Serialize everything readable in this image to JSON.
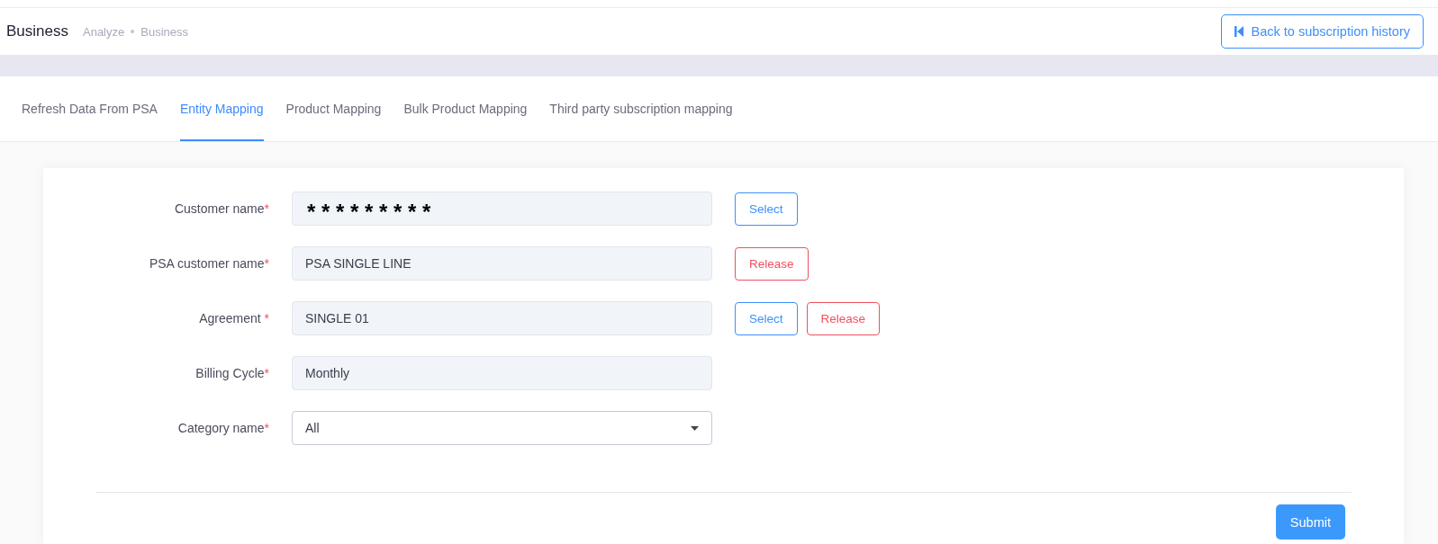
{
  "header": {
    "title": "Business",
    "breadcrumb": [
      "Analyze",
      "Business"
    ],
    "back_button": {
      "label": "Back to subscription history"
    }
  },
  "tabs": [
    {
      "label": "Refresh Data From PSA",
      "selected": false
    },
    {
      "label": "Entity Mapping",
      "selected": true
    },
    {
      "label": "Product Mapping",
      "selected": false
    },
    {
      "label": "Bulk Product Mapping",
      "selected": false
    },
    {
      "label": "Third party subscription mapping",
      "selected": false
    }
  ],
  "form": {
    "fields": [
      {
        "label": "Customer name",
        "required_mark": "*",
        "kind": "masked",
        "value": "* * * * * * * * *",
        "disabled": true,
        "actions": [
          {
            "label": "Select",
            "kind": "select"
          }
        ]
      },
      {
        "label": "PSA customer name",
        "required_mark": "*",
        "kind": "text",
        "value": "PSA SINGLE LINE",
        "disabled": true,
        "actions": [
          {
            "label": "Release",
            "kind": "release"
          }
        ]
      },
      {
        "label": "Agreement",
        "required_mark": " *",
        "kind": "text",
        "value": "SINGLE 01",
        "disabled": true,
        "actions": [
          {
            "label": "Select",
            "kind": "select"
          },
          {
            "label": "Release",
            "kind": "release"
          }
        ]
      },
      {
        "label": "Billing Cycle",
        "required_mark": "*",
        "kind": "text",
        "value": "Monthly",
        "disabled": true
      },
      {
        "label": "Category name",
        "required_mark": "*",
        "kind": "select",
        "value": "All",
        "disabled": false
      }
    ],
    "submit": {
      "label": "Submit"
    }
  }
}
